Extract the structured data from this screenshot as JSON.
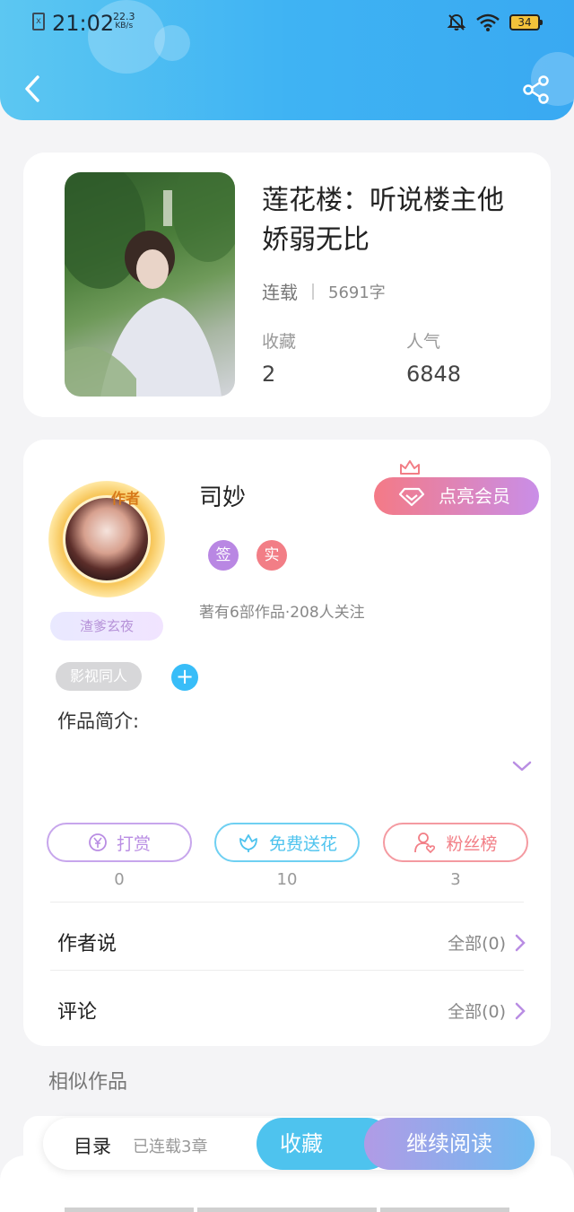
{
  "status_bar": {
    "time": "21:02",
    "speed_value": "22.3",
    "speed_unit": "KB/s",
    "battery": "34",
    "sim_label": "x"
  },
  "nav": {
    "back_icon": "chevron-left-icon",
    "share_icon": "share-icon"
  },
  "book": {
    "title": "莲花楼：听说楼主他娇弱无比",
    "status": "连载",
    "word_count": "5691字",
    "favorites_label": "收藏",
    "favorites_value": "2",
    "popularity_label": "人气",
    "popularity_value": "6848"
  },
  "author": {
    "badge_text": "作者",
    "name": "司妙",
    "nickname_tag": "渣爹玄夜",
    "vip_button": "点亮会员",
    "badges": [
      {
        "label": "签",
        "color": "#b987e3"
      },
      {
        "label": "实",
        "color": "#f27e86"
      }
    ],
    "stats": "著有6部作品·208人关注"
  },
  "tags": {
    "genre": "影视同人",
    "add": "+"
  },
  "synopsis_label": "作品简介:",
  "actions": [
    {
      "label": "打赏",
      "count": "0",
      "color": "#b98de3",
      "icon": "yen-icon"
    },
    {
      "label": "免费送花",
      "count": "10",
      "color": "#4ec3ee",
      "icon": "flower-icon"
    },
    {
      "label": "粉丝榜",
      "count": "3",
      "color": "#f27e86",
      "icon": "fans-icon"
    }
  ],
  "author_says": {
    "label": "作者说",
    "link": "全部(0)"
  },
  "comments": {
    "label": "评论",
    "link": "全部(0)"
  },
  "similar_label": "相似作品",
  "peek": {
    "bracket": "【"
  },
  "bottom_bar": {
    "catalog": "目录",
    "chapters": "已连载3章",
    "collect": "收藏",
    "read": "继续阅读"
  },
  "colors": {
    "header": "#3fb3f3",
    "accent_purple": "#b98de3",
    "accent_blue": "#4ec3ee",
    "accent_red": "#f27e86"
  }
}
